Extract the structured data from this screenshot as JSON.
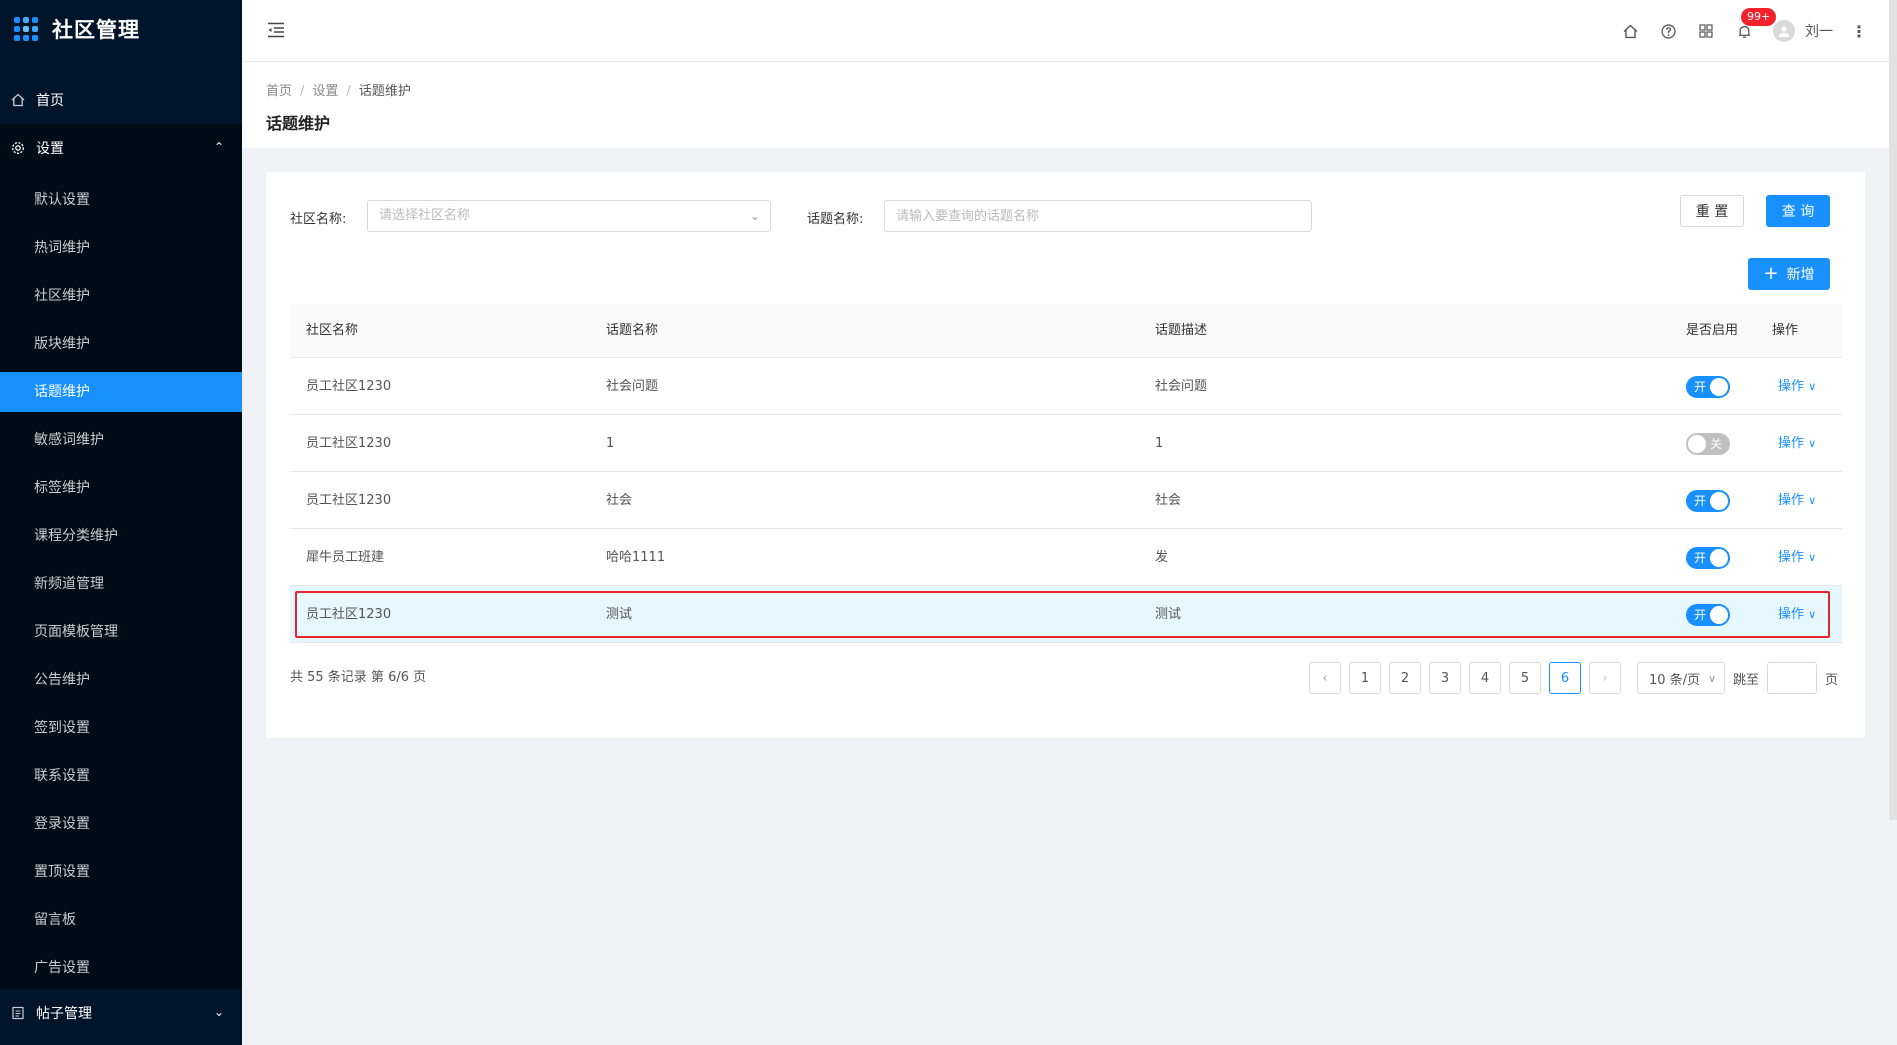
{
  "app": {
    "title": "社区管理",
    "accent": "#1890ff",
    "sidebar_bg": "#001529"
  },
  "sidebar": {
    "home_label": "首页",
    "settings_label": "设置",
    "settings_items": [
      "默认设置",
      "热词维护",
      "社区维护",
      "版块维护",
      "话题维护",
      "敏感词维护",
      "标签维护",
      "课程分类维护",
      "新频道管理",
      "页面模板管理",
      "公告维护",
      "签到设置",
      "联系设置",
      "登录设置",
      "置顶设置",
      "留言板",
      "广告设置"
    ],
    "active_item": "话题维护",
    "posts_label": "帖子管理"
  },
  "header": {
    "notification_badge": "99+",
    "username": "刘一",
    "icons": [
      "menu-fold-icon",
      "home-icon",
      "help-icon",
      "apps-icon",
      "bell-icon",
      "avatar-icon",
      "more-icon"
    ]
  },
  "breadcrumb": {
    "items": [
      "首页",
      "设置"
    ],
    "current": "话题维护"
  },
  "page_title": "话题维护",
  "filters": {
    "community_label": "社区名称:",
    "community_placeholder": "请选择社区名称",
    "topic_label": "话题名称:",
    "topic_placeholder": "请输入要查询的话题名称",
    "reset_label": "重 置",
    "search_label": "查 询",
    "add_label": "新增"
  },
  "table": {
    "columns": [
      "社区名称",
      "话题名称",
      "话题描述",
      "是否启用",
      "操作"
    ],
    "rows": [
      {
        "community": "员工社区1230",
        "topic": "社会问题",
        "desc": "社会问题",
        "enabled": true,
        "switch_text": "开",
        "action": "操作"
      },
      {
        "community": "员工社区1230",
        "topic": "1",
        "desc": "1",
        "enabled": false,
        "switch_text": "关",
        "action": "操作"
      },
      {
        "community": "员工社区1230",
        "topic": "社会",
        "desc": "社会",
        "enabled": true,
        "switch_text": "开",
        "action": "操作"
      },
      {
        "community": "犀牛员工班建",
        "topic": "哈哈1111",
        "desc": "发",
        "enabled": true,
        "switch_text": "开",
        "action": "操作"
      },
      {
        "community": "员工社区1230",
        "topic": "测试",
        "desc": "测试",
        "enabled": true,
        "switch_text": "开",
        "action": "操作"
      }
    ]
  },
  "pagination": {
    "summary": "共 55 条记录 第 6/6 页",
    "pages": [
      "1",
      "2",
      "3",
      "4",
      "5",
      "6"
    ],
    "current": "6",
    "page_size": "10 条/页",
    "jump_label": "跳至",
    "page_suffix": "页"
  }
}
